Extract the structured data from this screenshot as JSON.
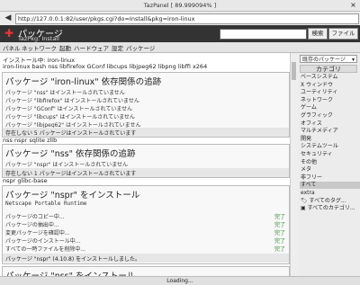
{
  "window": {
    "title": "TazPanel [ 89.999094% ]",
    "close_glyph": "×"
  },
  "browser": {
    "url": "http://127.0.0.1:82/user/pkgs.cgi?do=Install&pkg=iron-linux",
    "back_glyph": "◀"
  },
  "header": {
    "title": "パッケージ",
    "subtitle": "TazPkg: Install",
    "search_button": "検索",
    "files_button": "ファイル"
  },
  "menu": [
    "パネル",
    "ネットワーク",
    "起動",
    "ハードウェア",
    "設定",
    "パッケージ"
  ],
  "main": {
    "install_label": "インストール中: iron-linux",
    "deps_line": "iron-linux bash nss libfirefox GConf libcups libjpeg62 libpng libffi x264",
    "box1": {
      "title": "パッケージ \"iron-linux\" 依存関係の追跡",
      "rows": [
        "パッケージ \"nss\" はインストールされていません",
        "パッケージ \"libfirefox\" はインストールされていません",
        "パッケージ \"GConf\" はインストールされていません",
        "パッケージ \"libcups\" はインストールされていません",
        "パッケージ \"libjpeg62\" はインストールされていません"
      ],
      "footer": "存在しない 5 パッケージはインストールされています"
    },
    "nss_line": "nss nspr sqlite zlib",
    "box2": {
      "title": "パッケージ \"nss\" 依存関係の追跡",
      "rows": [
        "パッケージ \"nspr\" はインストールされていません"
      ],
      "footer": "存在しない 1 パッケージはインストールされています"
    },
    "nspr_line": "nspr glibc-base",
    "box3": {
      "title": "パッケージ \"nspr\" をインストール",
      "desc": "Netscape Portable Runtime",
      "rows": [
        {
          "text": "パッケージのコピー中...",
          "status": "完了"
        },
        {
          "text": "パッケージの抽出中...",
          "status": "完了"
        },
        {
          "text": "変更パッケージを確認中...",
          "status": "完了"
        },
        {
          "text": "パッケージのインストール中...",
          "status": "完了"
        },
        {
          "text": "すべての一時ファイルを削除中...",
          "status": "完了"
        }
      ],
      "footer": "パッケージ \"nspr\" (4.10.8) をインストールしました。"
    },
    "box4": {
      "title": "パッケージ \"nss\" をインストール"
    }
  },
  "sidebar": {
    "select_label": "既存のパッケージ",
    "heading": "カテゴリ",
    "categories": [
      "ベースシステム",
      "X ウィンドウ",
      "ユーティリティ",
      "ネットワーク",
      "ゲーム",
      "グラフィック",
      "オフィス",
      "マルチメディア",
      "開発",
      "システムツール",
      "セキュリティ",
      "その他",
      "メタ",
      "非フリー",
      "すべて",
      "extra",
      "すべてのタグ...",
      "すべてのカテゴリ..."
    ],
    "selected_index": 14
  },
  "status": {
    "text": "Loading..."
  }
}
